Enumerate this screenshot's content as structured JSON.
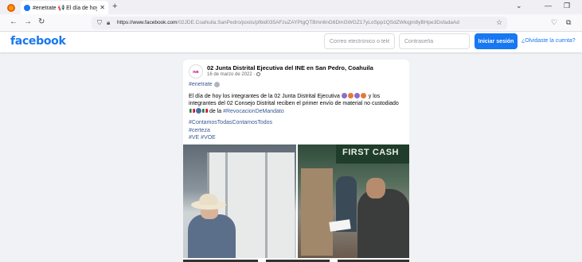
{
  "browser": {
    "tab_title": "#enetrate 📢 El día de hoy lo...",
    "tab_close": "✕",
    "new_tab": "+",
    "url_host": "https://www.facebook.com",
    "url_path": "/02JDE.Coahuila.SanPedro/posts/pfbid035AFzuZAYPtgQTBmn6nG6DmGWGZ17yLoSpp1QSdZWkqjm8yBHpe3DsfadaAd",
    "icons": [
      "firefox-icon",
      "back-icon",
      "forward-icon",
      "reload-icon",
      "shield-icon",
      "lock-icon",
      "bookmark-star-icon",
      "pocket-icon",
      "extensions-icon",
      "minimize-icon",
      "maximize-icon"
    ]
  },
  "header": {
    "logo": "facebook",
    "email_placeholder": "Correo electrónico o telé",
    "password_placeholder": "Contraseña",
    "login_label": "Iniciar sesión",
    "forgot_label": "¿Olvidaste la cuenta?"
  },
  "post": {
    "avatar_text": "INE",
    "author": "02 Junta Distrital Ejecutiva del INE en San Pedro, Coahuila",
    "date": "16 de marzo de 2022 ·",
    "hashtag_top": "#enetrate",
    "body_text": "El día de hoy los integrantes de la 02 Junta Distrital Ejecutiva",
    "body_text_2": "y los integrantes del 02 Consejo Distrital reciben el primer envío de material no custodiado",
    "body_text_3": "de la",
    "hashtag_link": "#RevocacionDeMandato",
    "tags": [
      "#ContamosTodasContamosTodos",
      "#certeza",
      "#VE #VOE"
    ],
    "photo_sign": "FIRST CASH"
  },
  "colors": {
    "brand": "#1877f2",
    "background": "#f0f2f5",
    "hashtag": "#385898"
  }
}
